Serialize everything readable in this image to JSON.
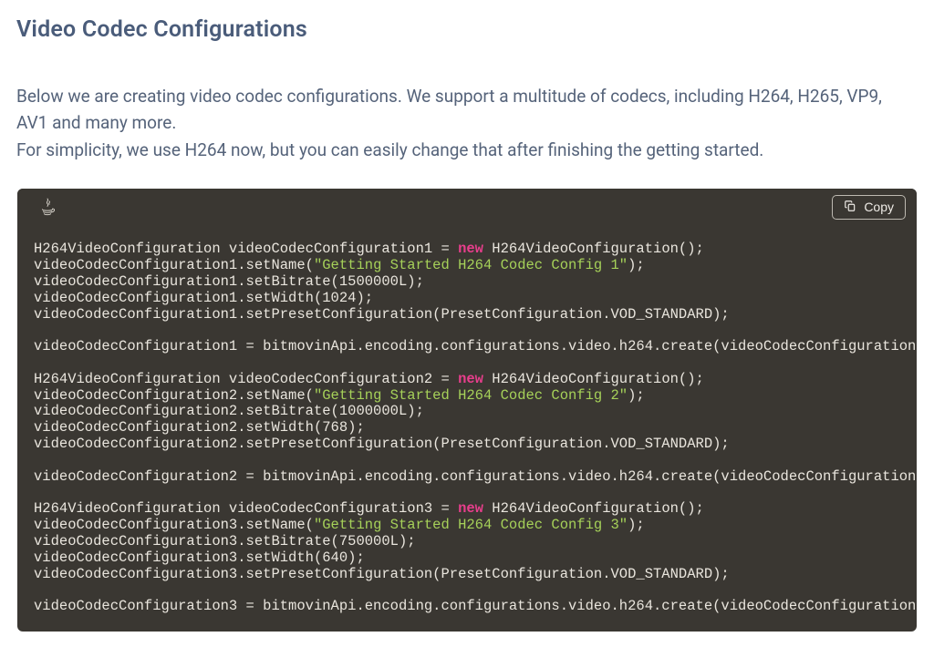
{
  "heading": "Video Codec Configurations",
  "intro_line1": "Below we are creating video codec configurations. We support a multitude of codecs, including H264, H265, VP9, AV1 and many more.",
  "intro_line2": "For simplicity, we use H264 now, but you can easily change that after finishing the getting started.",
  "copy_label": "Copy",
  "language": "Java",
  "code": {
    "typeName": "H264VideoConfiguration",
    "presetExpr": "PresetConfiguration.VOD_STANDARD",
    "createCallPrefix": "bitmovinApi.encoding.configurations.video.h264.create(",
    "vars": [
      {
        "name": "videoCodecConfiguration1",
        "displayName": "Getting Started H264 Codec Config 1",
        "bitrate": "1500000L",
        "width": "1024"
      },
      {
        "name": "videoCodecConfiguration2",
        "displayName": "Getting Started H264 Codec Config 2",
        "bitrate": "1000000L",
        "width": "768"
      },
      {
        "name": "videoCodecConfiguration3",
        "displayName": "Getting Started H264 Codec Config 3",
        "bitrate": "750000L",
        "width": "640"
      }
    ]
  }
}
